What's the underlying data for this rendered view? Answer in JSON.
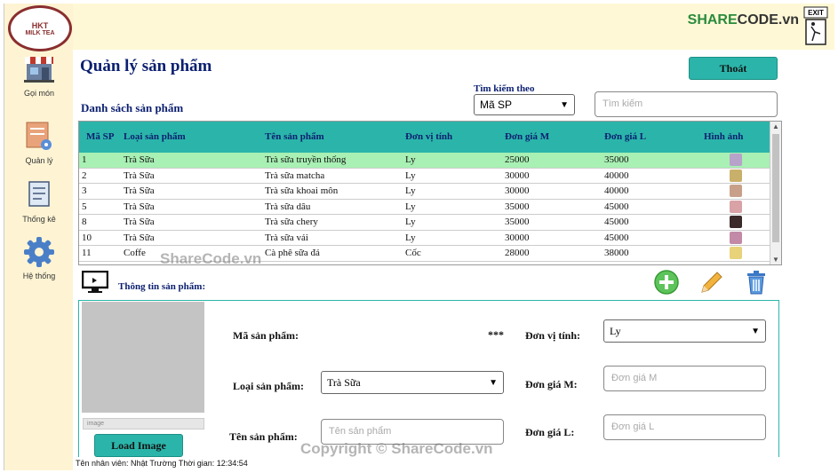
{
  "logo": {
    "line1": "HKT",
    "line2": "MILK TEA"
  },
  "sidebar": {
    "items": [
      {
        "label": "Gọi món",
        "icon": "store-icon"
      },
      {
        "label": "Quản lý",
        "icon": "manage-icon"
      },
      {
        "label": "Thống kê",
        "icon": "report-scroll-icon"
      },
      {
        "label": "Hệ thống",
        "icon": "gear-icon"
      }
    ]
  },
  "brand": {
    "share": "SHARE",
    "code": "CODE.vn"
  },
  "page": {
    "title": "Quản lý sản phẩm",
    "exit_button": "Thoát",
    "list_title": "Danh sách sản phẩm"
  },
  "search": {
    "label": "Tìm kiếm theo",
    "selected": "Mã SP",
    "placeholder": "Tìm kiếm"
  },
  "table": {
    "headers": [
      "Mã SP",
      "Loại sản phẩm",
      "Tên sản phẩm",
      "Đơn vị tính",
      "Đơn giá M",
      "Đơn giá L",
      "Hình ảnh"
    ],
    "rows": [
      [
        "1",
        "Trà Sữa",
        "Trà sữa truyền thống",
        "Ly",
        "25000",
        "35000"
      ],
      [
        "2",
        "Trà Sữa",
        "Trà sữa matcha",
        "Ly",
        "30000",
        "40000"
      ],
      [
        "3",
        "Trà Sữa",
        "Trà sữa khoai môn",
        "Ly",
        "30000",
        "40000"
      ],
      [
        "5",
        "Trà Sữa",
        "Trà sữa dâu",
        "Ly",
        "35000",
        "45000"
      ],
      [
        "8",
        "Trà Sữa",
        "Trà sữa chery",
        "Ly",
        "35000",
        "45000"
      ],
      [
        "10",
        "Trà Sữa",
        "Trà sữa vải",
        "Ly",
        "30000",
        "45000"
      ],
      [
        "11",
        "Coffe",
        "Cà phê sữa đá",
        "Cốc",
        "28000",
        "38000"
      ]
    ],
    "thumb_colors": [
      "#b7a2c9",
      "#c9b06a",
      "#c8a08a",
      "#d8a2a6",
      "#3a2a2a",
      "#c28aa6",
      "#e8d27a"
    ]
  },
  "info": {
    "title": "Thông tin sản phẩm:"
  },
  "form": {
    "image_path": "image",
    "load_button": "Load Image",
    "ma_sp_label": "Mã sản phẩm:",
    "ma_sp_value": "***",
    "loai_label": "Loại sản phẩm:",
    "loai_value": "Trà Sữa",
    "ten_label": "Tên sản phẩm:",
    "ten_placeholder": "Tên sản phẩm",
    "dvt_label": "Đơn vị tính:",
    "dvt_value": "Ly",
    "giam_label": "Đơn giá M:",
    "giam_placeholder": "Đơn giá M",
    "gial_label": "Đơn giá L:",
    "gial_placeholder": "Đơn giá L"
  },
  "status": "Tên nhân viên: Nhật Trường  Thời gian: 12:34:54",
  "watermarks": {
    "center": "ShareCode.vn",
    "bottom": "Copyright © ShareCode.vn"
  },
  "colors": {
    "accent": "#2bb5aa",
    "selected_row": "#a8f0b4",
    "title": "#0b1f70",
    "sidebar": "#fef4d4"
  }
}
